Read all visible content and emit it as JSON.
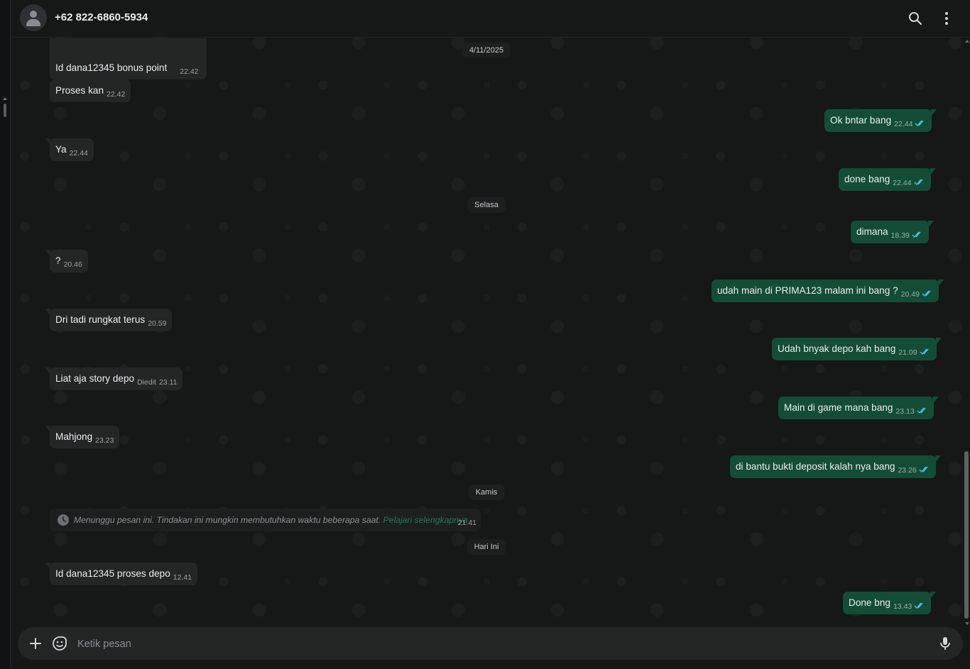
{
  "header": {
    "contact_name": "+62 822-6860-5934",
    "icons": [
      "search-icon",
      "more-vertical-icon"
    ]
  },
  "day_separators": [
    "4/11/2025",
    "Selasa",
    "Kamis",
    "Hari Ini"
  ],
  "messages": [
    {
      "dir": "in",
      "text": "Id dana12345 bonus point",
      "time": "22.42"
    },
    {
      "dir": "in",
      "text": "Proses kan",
      "time": "22.42"
    },
    {
      "dir": "out",
      "text": "Ok bntar bang",
      "time": "22.44"
    },
    {
      "dir": "in",
      "text": "Ya",
      "time": "22.44"
    },
    {
      "dir": "out",
      "text": "done bang",
      "time": "22.44"
    },
    {
      "dir": "out",
      "text": "dimana",
      "time": "18.39"
    },
    {
      "dir": "in",
      "text": "?",
      "time": "20.46"
    },
    {
      "dir": "out",
      "text": "udah main di PRIMA123 malam ini bang ?",
      "time": "20.49"
    },
    {
      "dir": "in",
      "text": "Dri tadi rungkat terus",
      "time": "20.59"
    },
    {
      "dir": "out",
      "text": "Udah bnyak depo kah bang",
      "time": "21.09"
    },
    {
      "dir": "in",
      "text": "Liat aja story depo",
      "edited": "Diedit",
      "time": "23.11"
    },
    {
      "dir": "out",
      "text": "Main di game mana bang",
      "time": "23.13"
    },
    {
      "dir": "in",
      "text": "Mahjong",
      "time": "23.23"
    },
    {
      "dir": "out",
      "text": "di bantu bukti deposit kalah nya bang",
      "time": "23.26"
    },
    {
      "dir": "in",
      "text": "Id dana12345 proses depo",
      "time": "12.41"
    },
    {
      "dir": "out",
      "text": "Done bng",
      "time": "13.43"
    }
  ],
  "pending": {
    "text": "Menunggu pesan ini. Tindakan ini mungkin membutuhkan waktu beberapa saat.",
    "link": "Pelajari selengkapnya",
    "time": "21.41"
  },
  "composer": {
    "placeholder": "Ketik pesan",
    "icons": [
      "plus-icon",
      "sticker-icon",
      "mic-icon"
    ]
  },
  "colors": {
    "incoming_bubble": "#242626",
    "outgoing_bubble": "#144d37",
    "read_ticks": "#53bdeb",
    "link": "#1f7a5c"
  }
}
